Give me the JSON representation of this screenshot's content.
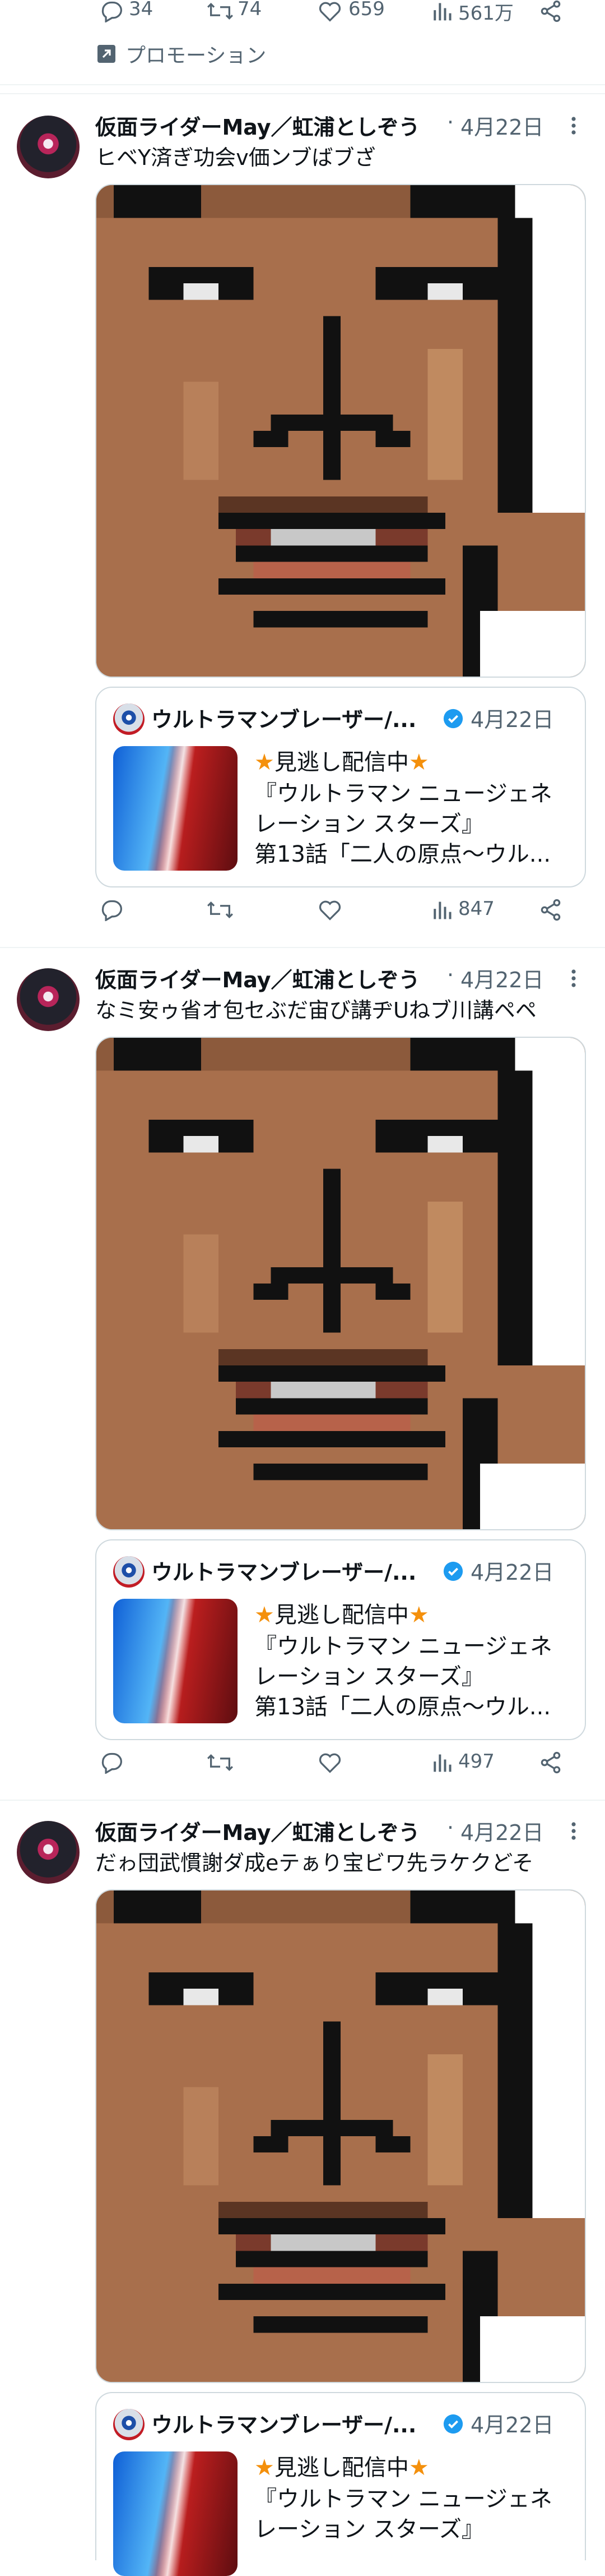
{
  "top_action_bar": {
    "reply_count": "34",
    "retweet_count": "74",
    "like_count": "659",
    "views_count": "561万"
  },
  "promotion_label": "プロモーション",
  "posts": [
    {
      "author": "仮面ライダーMay／虹浦としぞう",
      "separator": "·",
      "date": "4月22日",
      "text": "ヒベY済ぎ功会v価ンブばブざ",
      "card": {
        "source": "ウルトラマンブレーザー/...",
        "date": "4月22日",
        "line1": "★見逃し配信中★",
        "line2": "『ウルトラマン ニュージェネ",
        "line3": "レーション スターズ』",
        "line4": "第13話「二人の原点〜ウル..."
      },
      "views": "847"
    },
    {
      "author": "仮面ライダーMay／虹浦としぞう",
      "separator": "·",
      "date": "4月22日",
      "text": "なミ安ゥ省オ包セぶだ宙び講ヂUねブ川講ペペ",
      "card": {
        "source": "ウルトラマンブレーザー/...",
        "date": "4月22日",
        "line1": "★見逃し配信中★",
        "line2": "『ウルトラマン ニュージェネ",
        "line3": "レーション スターズ』",
        "line4": "第13話「二人の原点〜ウル..."
      },
      "views": "497"
    },
    {
      "author": "仮面ライダーMay／虹浦としぞう",
      "separator": "·",
      "date": "4月22日",
      "text": "だゎ団武慣謝ダ成eテぁり宝ビワ先ラケクどそ",
      "card": {
        "source": "ウルトラマンブレーザー/...",
        "date": "4月22日",
        "line1": "★見逃し配信中★",
        "line2": "『ウルトラマン ニュージェネ",
        "line3": "レーション スターズ』",
        "line4": ""
      },
      "views": ""
    }
  ],
  "colors": {
    "text": "#0f1419",
    "secondary": "#536471",
    "divider": "#eff3f4",
    "verified": "#1d9bf0",
    "star": "#f4900c",
    "skin": "#a86f4c"
  }
}
